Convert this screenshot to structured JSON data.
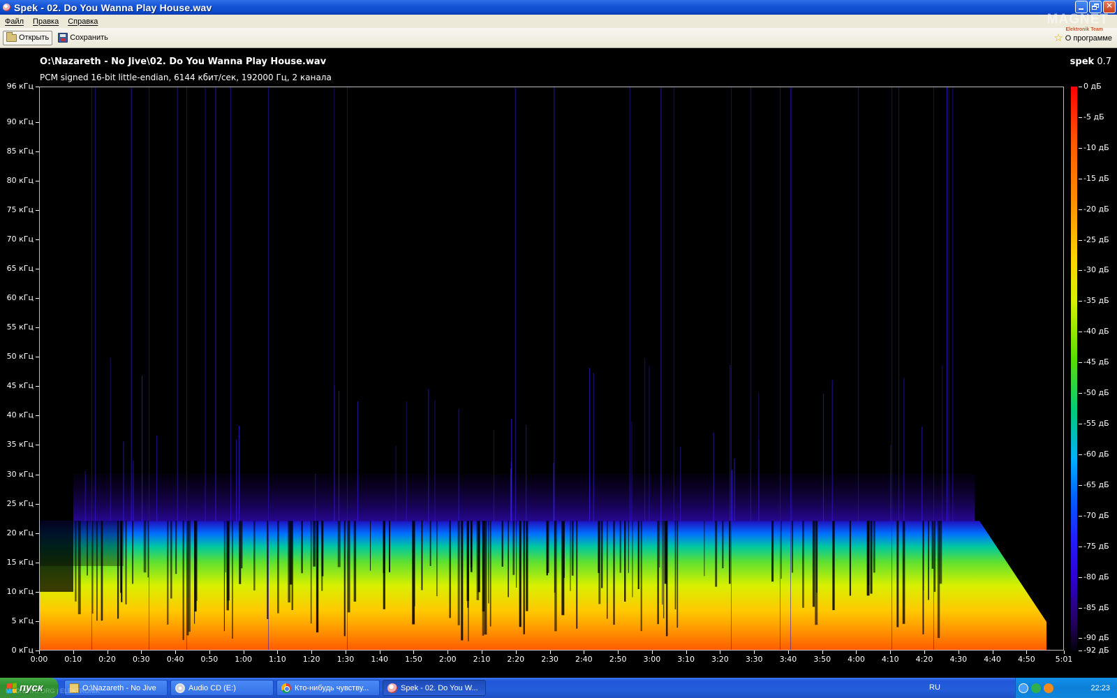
{
  "window": {
    "title": "Spek - 02. Do You Wanna Play House.wav",
    "controls": [
      "minimize",
      "maximize",
      "close"
    ]
  },
  "menu": {
    "items": [
      {
        "label": "Файл"
      },
      {
        "label": "Правка"
      },
      {
        "label": "Справка"
      }
    ]
  },
  "toolbar": {
    "open_label": "Открыть",
    "save_label": "Сохранить",
    "about_label": "О программе",
    "watermark": "MAGNET",
    "watermark_sub": "Elektronik Team"
  },
  "spectrogram": {
    "file_path": "O:\\Nazareth - No Jive\\02. Do You Wanna Play House.wav",
    "file_info": "PCM signed 16-bit little-endian, 6144 кбит/сек, 192000 Гц, 2 канала",
    "app_name_bold": "spek",
    "app_version": "0.7",
    "freq_labels": [
      "96 кГц",
      "90 кГц",
      "85 кГц",
      "80 кГц",
      "75 кГц",
      "70 кГц",
      "65 кГц",
      "60 кГц",
      "55 кГц",
      "50 кГц",
      "45 кГц",
      "40 кГц",
      "35 кГц",
      "30 кГц",
      "25 кГц",
      "20 кГц",
      "15 кГц",
      "10 кГц",
      "5 кГц",
      "0 кГц"
    ],
    "freq_values_khz": [
      96,
      90,
      85,
      80,
      75,
      70,
      65,
      60,
      55,
      50,
      45,
      40,
      35,
      30,
      25,
      20,
      15,
      10,
      5,
      0
    ],
    "time_labels": [
      "0:00",
      "0:10",
      "0:20",
      "0:30",
      "0:40",
      "0:50",
      "1:00",
      "1:10",
      "1:20",
      "1:30",
      "1:40",
      "1:50",
      "2:00",
      "2:10",
      "2:20",
      "2:30",
      "2:40",
      "2:50",
      "3:00",
      "3:10",
      "3:20",
      "3:30",
      "3:40",
      "3:50",
      "4:00",
      "4:10",
      "4:20",
      "4:30",
      "4:40",
      "4:50",
      "5:01"
    ],
    "time_values_sec": [
      0,
      10,
      20,
      30,
      40,
      50,
      60,
      70,
      80,
      90,
      100,
      110,
      120,
      130,
      140,
      150,
      160,
      170,
      180,
      190,
      200,
      210,
      220,
      230,
      240,
      250,
      260,
      270,
      280,
      290,
      301
    ],
    "db_labels": [
      "0 дБ",
      "-5 дБ",
      "-10 дБ",
      "-15 дБ",
      "-20 дБ",
      "-25 дБ",
      "-30 дБ",
      "-35 дБ",
      "-40 дБ",
      "-45 дБ",
      "-50 дБ",
      "-55 дБ",
      "-60 дБ",
      "-65 дБ",
      "-70 дБ",
      "-75 дБ",
      "-80 дБ",
      "-85 дБ",
      "-90 дБ",
      "-92 дБ"
    ],
    "db_values": [
      0,
      -5,
      -10,
      -15,
      -20,
      -25,
      -30,
      -35,
      -40,
      -45,
      -50,
      -55,
      -60,
      -65,
      -70,
      -75,
      -80,
      -85,
      -90,
      -92
    ],
    "duration_sec": 301,
    "max_freq_khz": 96,
    "content_cutoff_khz": 22,
    "fade_out_start_sec": 275,
    "colors": {
      "background": "#000000",
      "axis": "#ffffff",
      "hot": "#ff6a00",
      "mid": "#d8f000",
      "cool": "#0040ff",
      "floor": "#1a0050"
    }
  },
  "taskbar": {
    "start_label": "пуск",
    "tasks": [
      {
        "label": "O:\\Nazareth - No Jive",
        "icon": "folder-icon"
      },
      {
        "label": "Audio CD (E:)",
        "icon": "cd-icon"
      },
      {
        "label": "Кто-нибудь чувству...",
        "icon": "chrome-icon"
      },
      {
        "label": "Spek - 02. Do You W...",
        "icon": "spek-icon"
      }
    ],
    "language": "RU",
    "clock": "22:23",
    "watermark": "MAGNETAT.ORG | ELEKTRONIK"
  }
}
